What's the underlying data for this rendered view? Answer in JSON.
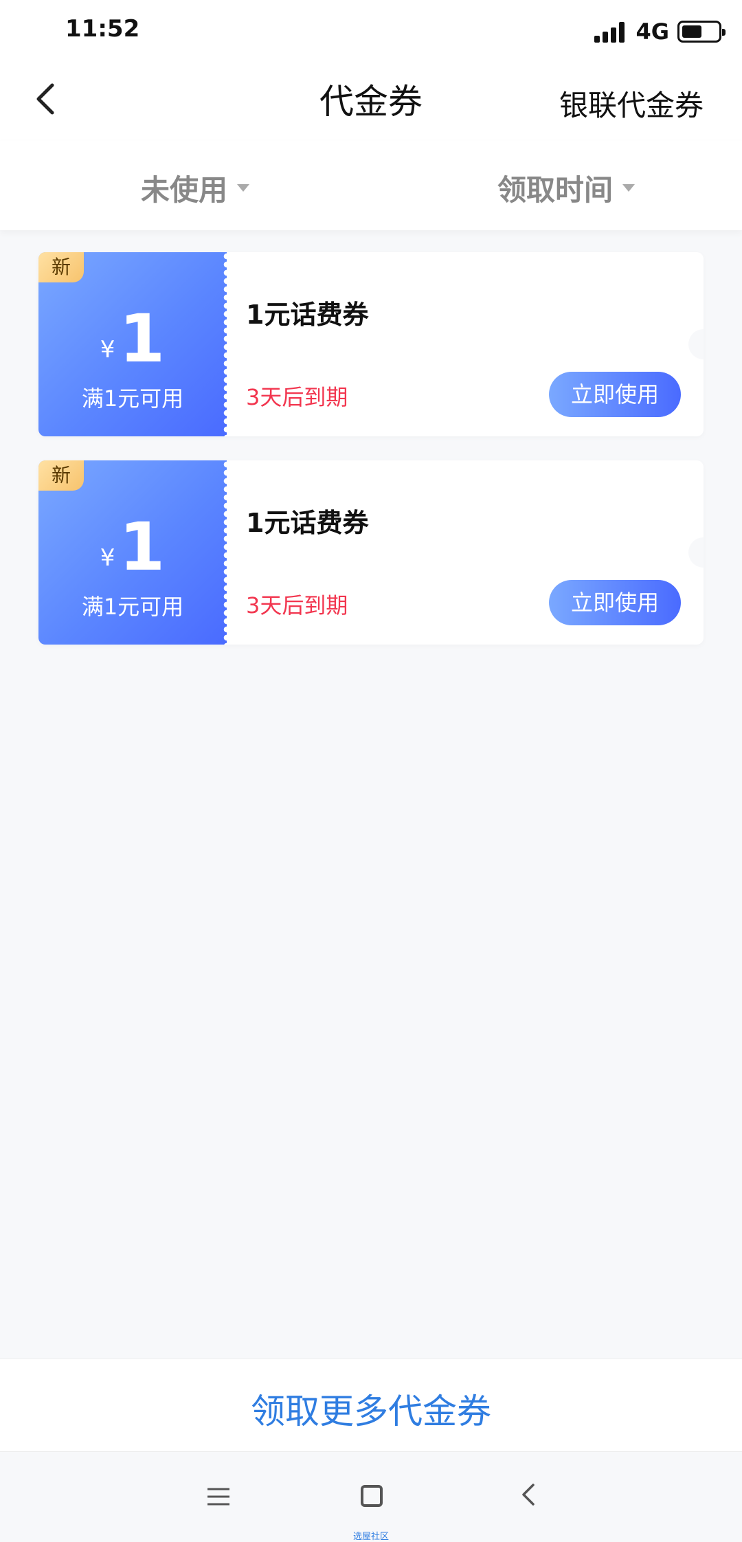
{
  "status_bar": {
    "time": "11:52",
    "network": "4G"
  },
  "nav": {
    "title": "代金券",
    "right_link": "银联代金券"
  },
  "filters": {
    "status": "未使用",
    "sort": "领取时间"
  },
  "coupons": [
    {
      "badge": "新",
      "currency": "¥",
      "amount": "1",
      "threshold": "满1元可用",
      "title": "1元话费券",
      "expiry": "3天后到期",
      "button": "立即使用"
    },
    {
      "badge": "新",
      "currency": "¥",
      "amount": "1",
      "threshold": "满1元可用",
      "title": "1元话费券",
      "expiry": "3天后到期",
      "button": "立即使用"
    }
  ],
  "bottom": {
    "more_link": "领取更多代金券"
  },
  "watermark": "选屋社区",
  "colors": {
    "accent_blue": "#2f7de1",
    "coupon_gradient_start": "#7aa8ff",
    "coupon_gradient_end": "#4a6bff",
    "expiry_red": "#f2364f",
    "badge_gold": "#f7c36d"
  }
}
